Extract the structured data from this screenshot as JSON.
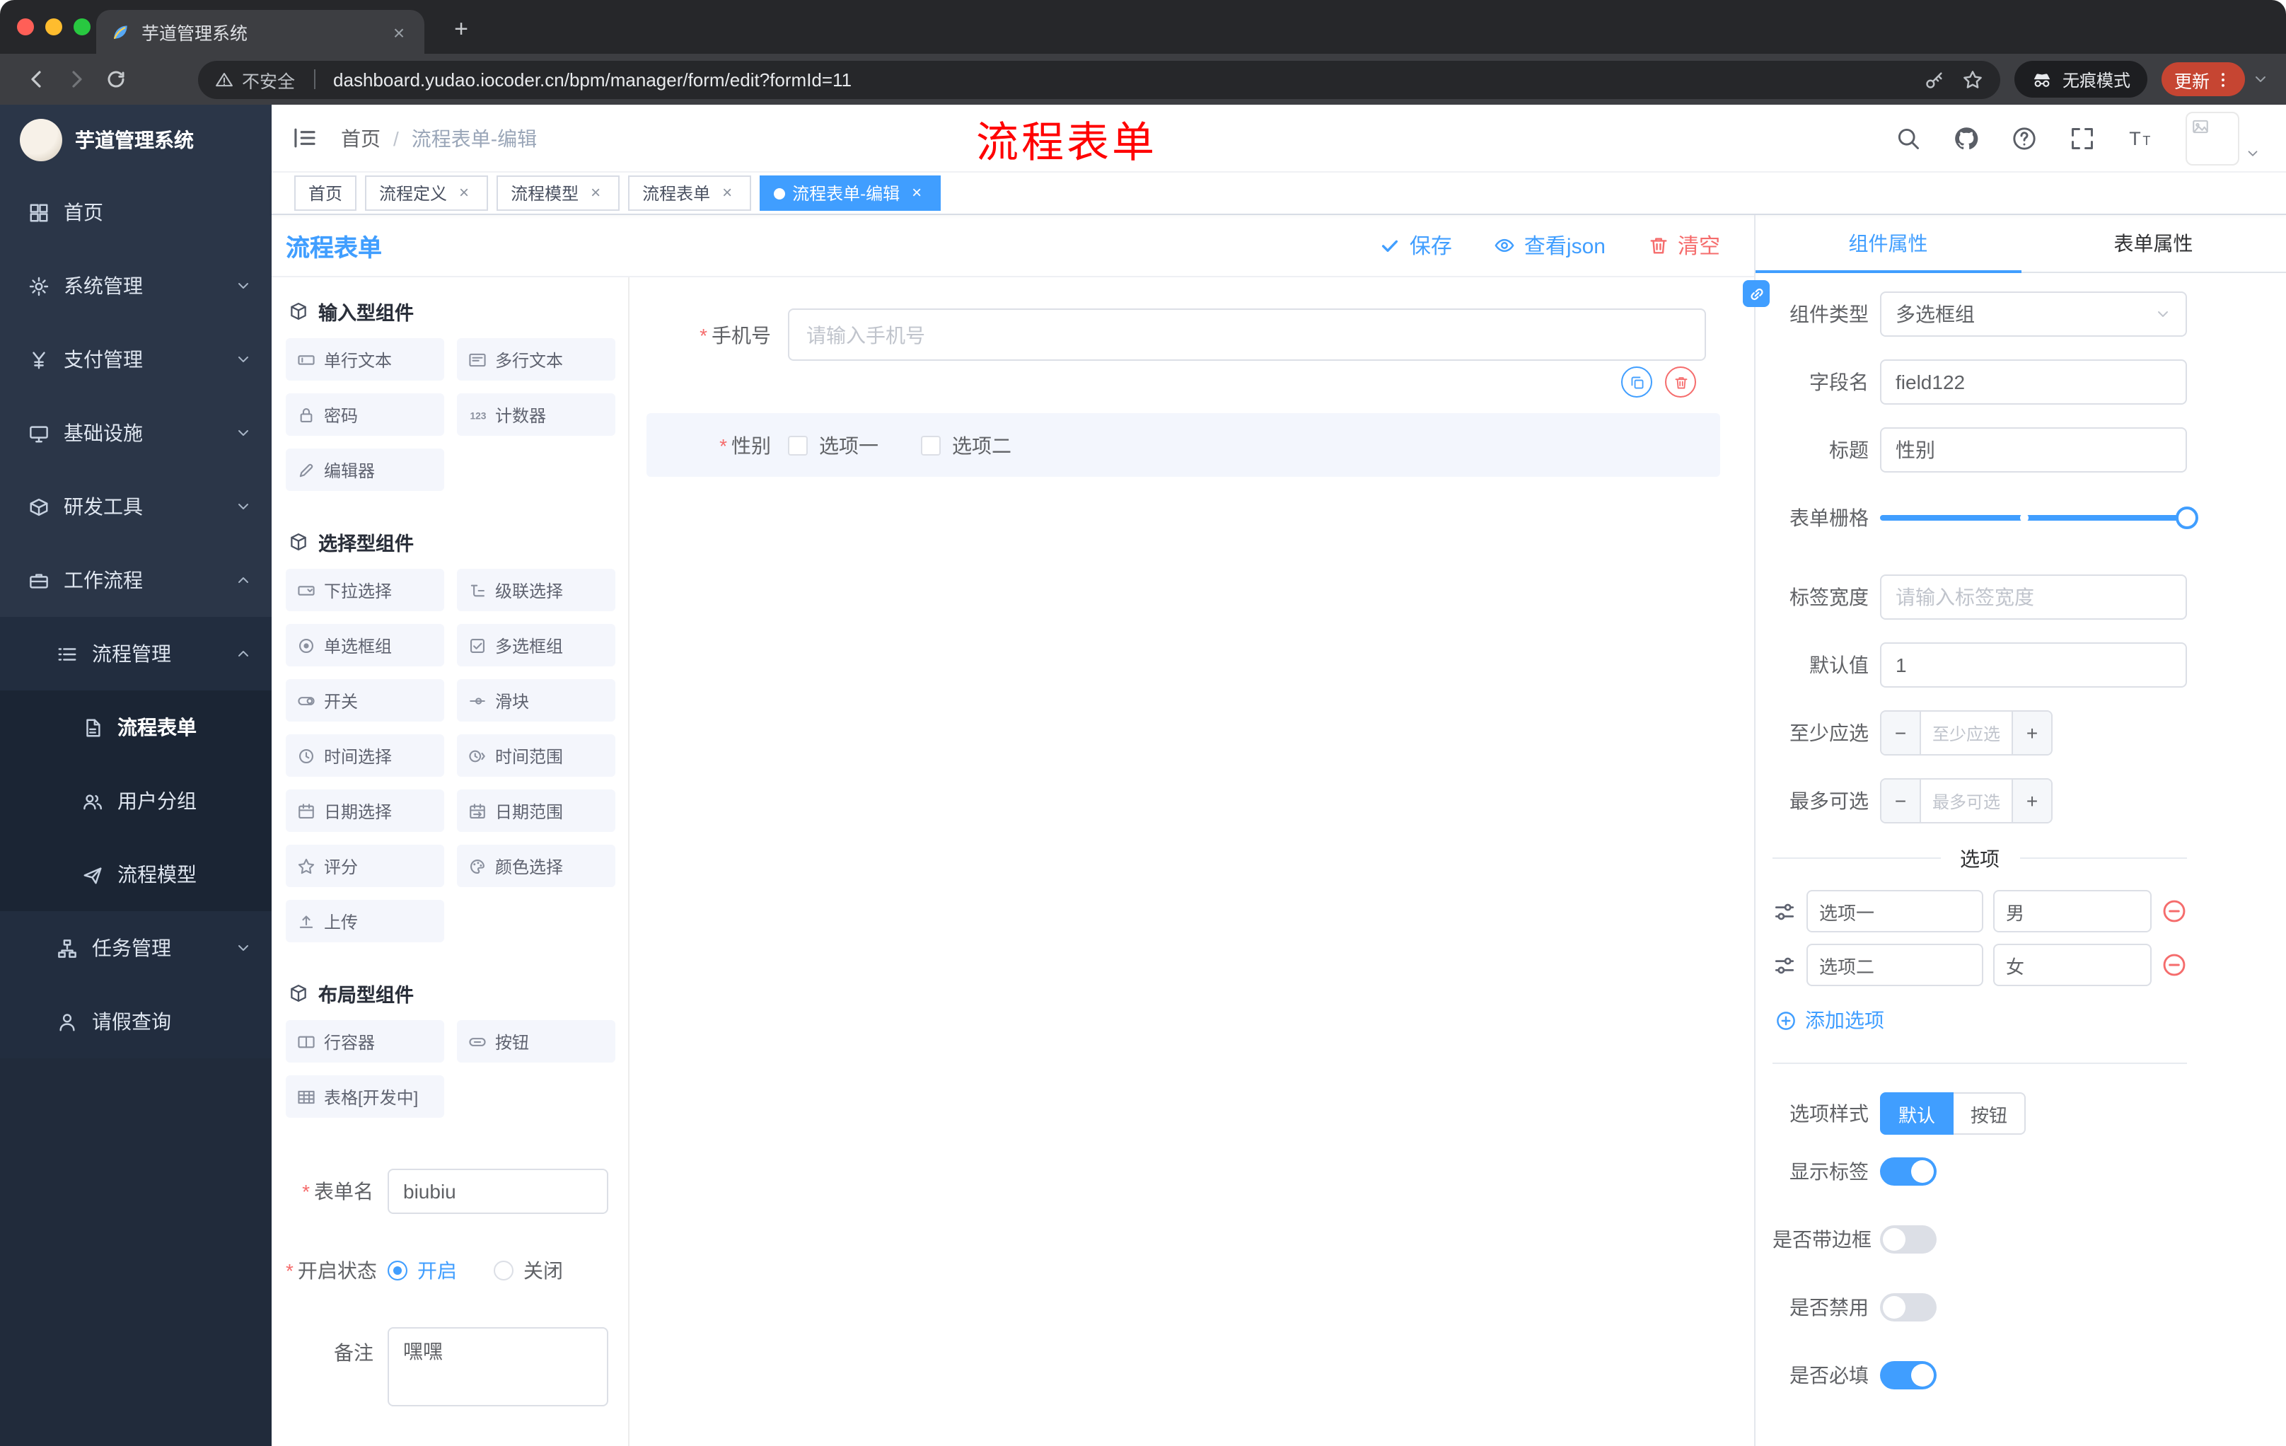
{
  "colors": {
    "accent": "#409eff",
    "danger": "#f56c6c",
    "annotation_red": "#ff0000",
    "sidebar_bg": "#2b3648"
  },
  "browser": {
    "tab_title": "芋道管理系统",
    "new_tab": "+",
    "security_label": "不安全",
    "url": "dashboard.yudao.iocoder.cn/bpm/manager/form/edit?formId=11",
    "incognito_label": "无痕模式",
    "update_label": "更新"
  },
  "sidebar": {
    "logo_title": "芋道管理系统",
    "items": [
      {
        "label": "首页",
        "icon": "dashboard-icon",
        "level": 1
      },
      {
        "label": "系统管理",
        "icon": "gear-icon",
        "level": 1,
        "expandable": true
      },
      {
        "label": "支付管理",
        "icon": "yen-icon",
        "level": 1,
        "expandable": true
      },
      {
        "label": "基础设施",
        "icon": "infrastructure-icon",
        "level": 1,
        "expandable": true
      },
      {
        "label": "研发工具",
        "icon": "devtools-icon",
        "level": 1,
        "expandable": true
      },
      {
        "label": "工作流程",
        "icon": "workflow-icon",
        "level": 1,
        "expanded": true
      },
      {
        "label": "流程管理",
        "icon": "list-icon",
        "level": 2,
        "expanded": true
      },
      {
        "label": "流程表单",
        "icon": "form-icon",
        "level": 3,
        "active": true
      },
      {
        "label": "用户分组",
        "icon": "users-icon",
        "level": 3
      },
      {
        "label": "流程模型",
        "icon": "paper-plane-icon",
        "level": 3
      },
      {
        "label": "任务管理",
        "icon": "org-tree-icon",
        "level": 2,
        "expandable": true
      },
      {
        "label": "请假查询",
        "icon": "person-icon",
        "level": 2
      }
    ]
  },
  "header": {
    "breadcrumb": {
      "home": "首页",
      "separator": "/",
      "current": "流程表单-编辑"
    },
    "annotation": "流程表单"
  },
  "tags": [
    {
      "label": "首页",
      "closable": false,
      "active": false
    },
    {
      "label": "流程定义",
      "closable": true,
      "active": false
    },
    {
      "label": "流程模型",
      "closable": true,
      "active": false
    },
    {
      "label": "流程表单",
      "closable": true,
      "active": false
    },
    {
      "label": "流程表单-编辑",
      "closable": true,
      "active": true
    }
  ],
  "designer": {
    "title": "流程表单",
    "actions": {
      "save": "保存",
      "view_json": "查看json",
      "clear": "清空"
    },
    "palette": {
      "sections": [
        {
          "title": "输入型组件",
          "items": [
            {
              "label": "单行文本",
              "icon": "text-input-icon"
            },
            {
              "label": "多行文本",
              "icon": "textarea-icon"
            },
            {
              "label": "密码",
              "icon": "password-icon"
            },
            {
              "label": "计数器",
              "icon": "counter-icon"
            },
            {
              "label": "编辑器",
              "icon": "editor-icon"
            }
          ]
        },
        {
          "title": "选择型组件",
          "items": [
            {
              "label": "下拉选择",
              "icon": "select-icon"
            },
            {
              "label": "级联选择",
              "icon": "cascader-icon"
            },
            {
              "label": "单选框组",
              "icon": "radio-icon"
            },
            {
              "label": "多选框组",
              "icon": "checkbox-icon"
            },
            {
              "label": "开关",
              "icon": "switch-icon"
            },
            {
              "label": "滑块",
              "icon": "slider-icon"
            },
            {
              "label": "时间选择",
              "icon": "time-icon"
            },
            {
              "label": "时间范围",
              "icon": "time-range-icon"
            },
            {
              "label": "日期选择",
              "icon": "date-icon"
            },
            {
              "label": "日期范围",
              "icon": "date-range-icon"
            },
            {
              "label": "评分",
              "icon": "rate-icon"
            },
            {
              "label": "颜色选择",
              "icon": "color-icon"
            },
            {
              "label": "上传",
              "icon": "upload-icon"
            }
          ]
        },
        {
          "title": "布局型组件",
          "items": [
            {
              "label": "行容器",
              "icon": "row-container-icon"
            },
            {
              "label": "按钮",
              "icon": "button-icon"
            },
            {
              "label": "表格[开发中]",
              "icon": "table-icon"
            }
          ]
        }
      ]
    },
    "form": {
      "name_label": "表单名",
      "name_value": "biubiu",
      "status_label": "开启状态",
      "status_on": "开启",
      "status_off": "关闭",
      "remark_label": "备注",
      "remark_value": "嘿嘿"
    },
    "canvas": {
      "phone": {
        "label": "手机号",
        "placeholder": "请输入手机号"
      },
      "gender": {
        "label": "性别",
        "option1": "选项一",
        "option2": "选项二"
      }
    }
  },
  "props": {
    "tab_component": "组件属性",
    "tab_form": "表单属性",
    "type_label": "组件类型",
    "type_value": "多选框组",
    "field_label": "字段名",
    "field_value": "field122",
    "title_label": "标题",
    "title_value": "性别",
    "grid_label": "表单栅格",
    "label_width_label": "标签宽度",
    "label_width_placeholder": "请输入标签宽度",
    "default_label": "默认值",
    "default_value": "1",
    "min_label": "至少应选",
    "min_placeholder": "至少应选",
    "max_label": "最多可选",
    "max_placeholder": "最多可选",
    "options_title": "选项",
    "options": [
      {
        "label": "选项一",
        "value": "男"
      },
      {
        "label": "选项二",
        "value": "女"
      }
    ],
    "add_option": "添加选项",
    "style_label": "选项样式",
    "style_default": "默认",
    "style_button": "按钮",
    "switch_show_label": "显示标签",
    "switch_border": "是否带边框",
    "switch_disabled": "是否禁用",
    "switch_required": "是否必填",
    "switch_states": {
      "show_label": true,
      "border": false,
      "disabled": false,
      "required": true
    }
  }
}
